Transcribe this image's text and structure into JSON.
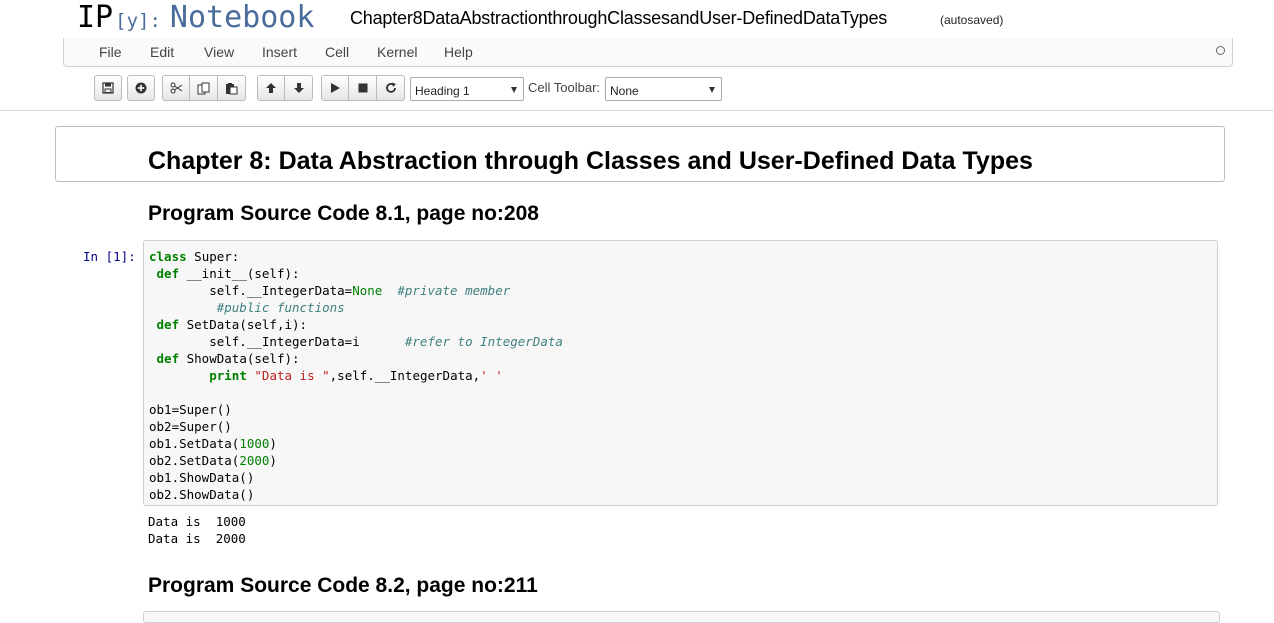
{
  "header": {
    "logo_ip": "IP",
    "logo_y": "[y]:",
    "logo_notebook": "Notebook",
    "notebook_name": "Chapter8DataAbstractionthroughClassesandUser-DefinedDataTypes",
    "save_status": "(autosaved)"
  },
  "menubar": {
    "items": [
      "File",
      "Edit",
      "View",
      "Insert",
      "Cell",
      "Kernel",
      "Help"
    ]
  },
  "toolbar": {
    "buttons": [
      "save-icon",
      "add-cell-icon",
      "cut-icon",
      "copy-icon",
      "paste-icon",
      "move-up-icon",
      "move-down-icon",
      "run-icon",
      "stop-icon",
      "restart-icon"
    ],
    "cell_type_value": "Heading 1",
    "cell_toolbar_label": "Cell Toolbar:",
    "cell_toolbar_value": "None"
  },
  "notebook": {
    "chapter_heading": "Chapter 8: Data Abstraction through Classes and User-Defined Data Types",
    "section_heading_1": "Program Source Code 8.1, page no:208",
    "input_prompt": "In [1]:",
    "code_lines": [
      "class Super:",
      " def __init__(self):",
      "        self.__IntegerData=None  #private member",
      "         #public functions",
      " def SetData(self,i):",
      "        self.__IntegerData=i      #refer to IntegerData",
      " def ShowData(self):",
      "        print \"Data is \",self.__IntegerData,' '",
      "",
      "ob1=Super()",
      "ob2=Super()",
      "ob1.SetData(1000)",
      "ob2.SetData(2000)",
      "ob1.ShowData()",
      "ob2.ShowData()"
    ],
    "output_lines": [
      "Data is  1000",
      "Data is  2000"
    ],
    "section_heading_2": "Program Source Code 8.2, page no:211"
  }
}
